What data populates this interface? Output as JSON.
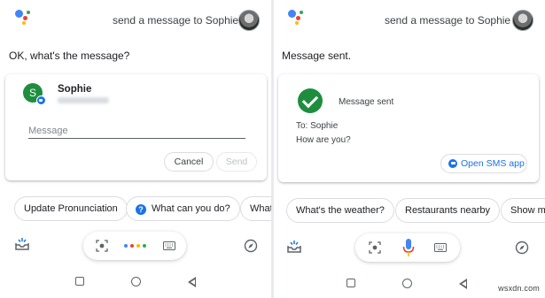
{
  "left_screen": {
    "query": "send a message to Sophie",
    "response": "OK, what's the message?",
    "contact": {
      "initial": "S",
      "name": "Sophie"
    },
    "message_input": {
      "value": "",
      "placeholder": "Message"
    },
    "cancel_label": "Cancel",
    "send_label": "Send",
    "chips": [
      "Update Pronunciation",
      "What can you do?",
      "What'"
    ]
  },
  "right_screen": {
    "query": "send a message to Sophie",
    "response": "Message sent.",
    "card": {
      "status": "Message sent",
      "to": "To: Sophie",
      "body": "How are you?",
      "open_button": "Open SMS app"
    },
    "chips": [
      "What's the weather?",
      "Restaurants nearby",
      "Show m"
    ]
  },
  "icons": {
    "assistant_logo": "google-assistant-logo",
    "lens": "lens-icon",
    "keyboard": "keyboard-icon",
    "mic": "mic-icon",
    "explore": "compass-icon",
    "snapshot": "tray-icon"
  },
  "colors": {
    "blue": "#4285f4",
    "red": "#ea4335",
    "yellow": "#fbbc04",
    "green": "#34a853",
    "accent": "#1a73e8"
  },
  "watermark": "wsxdn.com"
}
